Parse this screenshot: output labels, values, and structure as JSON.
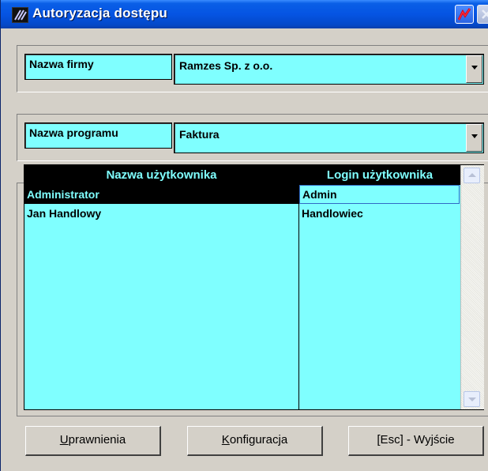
{
  "window": {
    "title": "Autoryzacja dostępu"
  },
  "company": {
    "label": "Nazwa firmy",
    "value": "Ramzes Sp. z o.o."
  },
  "program": {
    "label": "Nazwa programu",
    "value": "Faktura"
  },
  "users_table": {
    "columns": [
      "Nazwa użytkownika",
      "Login użytkownika"
    ],
    "rows": [
      {
        "name": "Administrator",
        "login": "Admin",
        "selected": true
      },
      {
        "name": "Jan Handlowy",
        "login": "Handlowiec",
        "selected": false
      }
    ]
  },
  "buttons": {
    "permissions": {
      "accel": "U",
      "rest": "prawnienia"
    },
    "configuration": {
      "accel": "K",
      "rest": "onfiguracja"
    },
    "exit": {
      "label": "[Esc] - Wyjście"
    }
  },
  "colors": {
    "field_bg": "#7fffff",
    "header_bg": "#000000",
    "title_blue": "#0554e3"
  },
  "icons": [
    "app-logo-icon",
    "help-icon",
    "close-icon",
    "dropdown-arrow-icon",
    "scroll-up-icon",
    "scroll-down-icon"
  ]
}
